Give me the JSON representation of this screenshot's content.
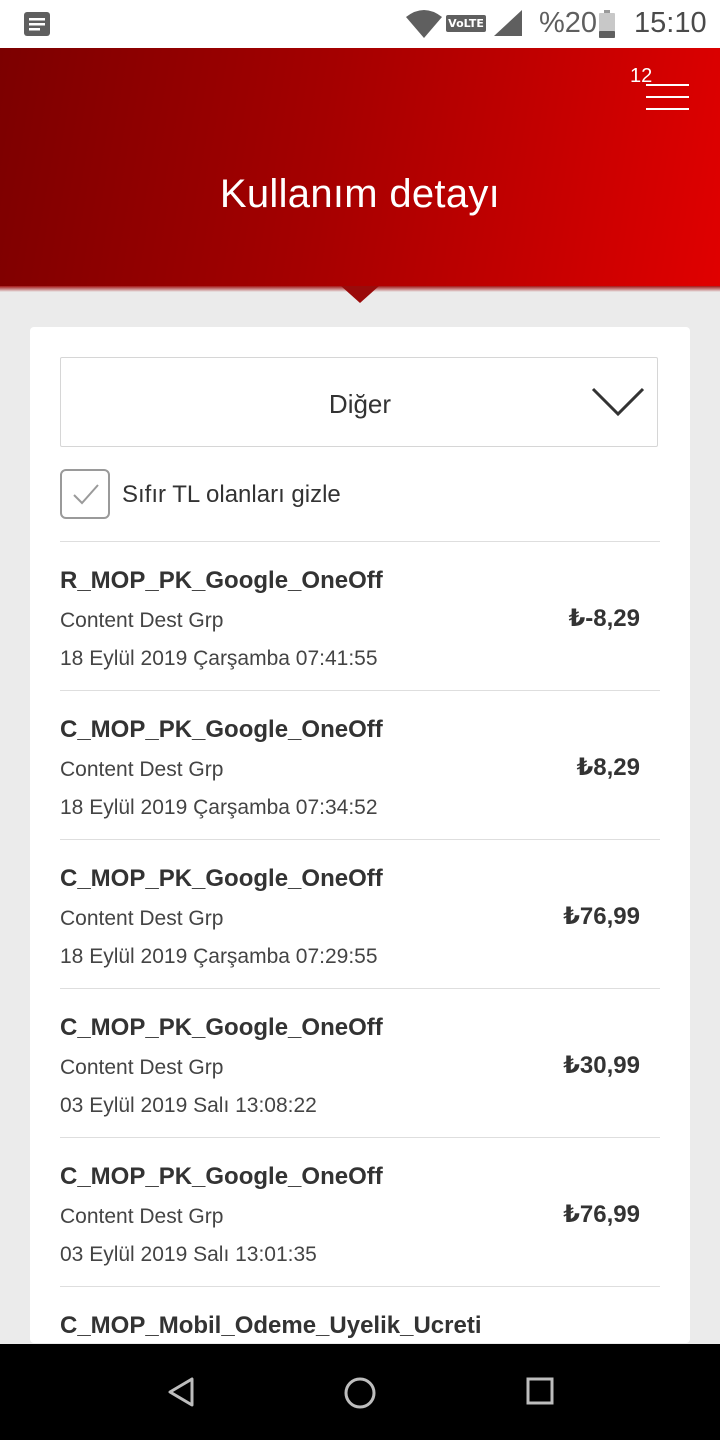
{
  "status_bar": {
    "battery_percent": "%20",
    "time": "15:10",
    "volte_label": "VoLTE",
    "icons": [
      "notification-icon",
      "wifi-icon",
      "volte-icon",
      "signal-icon",
      "battery-icon"
    ]
  },
  "header": {
    "title": "Kullanım detayı",
    "menu_badge": "12",
    "menu_icon": "hamburger-menu-icon",
    "background_colors": [
      "#7c0000",
      "#e00000"
    ]
  },
  "filter": {
    "dropdown_value": "Diğer",
    "hide_zero_label": "Sıfır TL olanları gizle",
    "hide_zero_checked": true
  },
  "transactions": [
    {
      "title": "R_MOP_PK_Google_OneOff",
      "subtitle": "Content Dest Grp",
      "date": "18 Eylül 2019 Çarşamba 07:41:55",
      "amount": "₺-8,29"
    },
    {
      "title": "C_MOP_PK_Google_OneOff",
      "subtitle": "Content Dest Grp",
      "date": "18 Eylül 2019 Çarşamba 07:34:52",
      "amount": "₺8,29"
    },
    {
      "title": "C_MOP_PK_Google_OneOff",
      "subtitle": "Content Dest Grp",
      "date": "18 Eylül 2019 Çarşamba 07:29:55",
      "amount": "₺76,99"
    },
    {
      "title": "C_MOP_PK_Google_OneOff",
      "subtitle": "Content Dest Grp",
      "date": "03 Eylül 2019 Salı 13:08:22",
      "amount": "₺30,99"
    },
    {
      "title": "C_MOP_PK_Google_OneOff",
      "subtitle": "Content Dest Grp",
      "date": "03 Eylül 2019 Salı 13:01:35",
      "amount": "₺76,99"
    },
    {
      "title": "C_MOP_Mobil_Odeme_Uyelik_Ucreti",
      "subtitle": "",
      "date": "",
      "amount": ""
    }
  ],
  "nav_bar": {
    "icons": [
      "back-icon",
      "home-icon",
      "recents-icon"
    ]
  }
}
